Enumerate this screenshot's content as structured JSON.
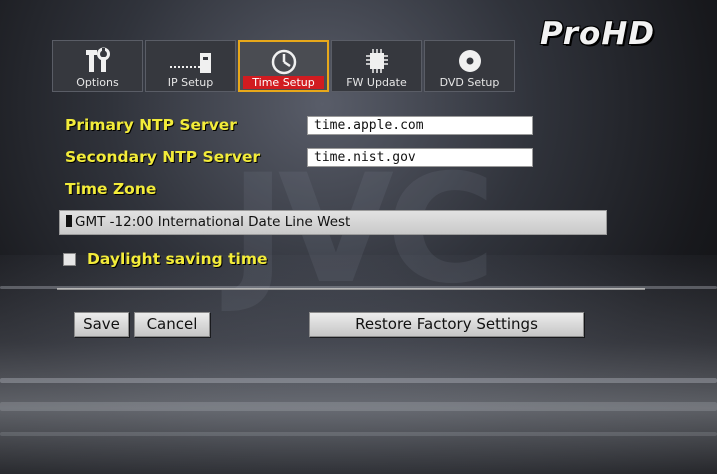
{
  "brand": "ProHD",
  "tabs": [
    {
      "label": "Options",
      "icon": "tools-icon"
    },
    {
      "label": "IP Setup",
      "icon": "network-plug-icon"
    },
    {
      "label": "Time Setup",
      "icon": "clock-icon",
      "active": true
    },
    {
      "label": "FW Update",
      "icon": "chip-icon"
    },
    {
      "label": "DVD Setup",
      "icon": "disc-icon"
    }
  ],
  "form": {
    "primary_ntp_label": "Primary NTP Server",
    "primary_ntp_value": "time.apple.com",
    "secondary_ntp_label": "Secondary NTP Server",
    "secondary_ntp_value": "time.nist.gov",
    "time_zone_label": "Time Zone",
    "time_zone_value": "GMT -12:00 International Date Line West",
    "daylight_label": "Daylight saving time",
    "daylight_checked": false
  },
  "buttons": {
    "save": "Save",
    "cancel": "Cancel",
    "restore": "Restore Factory Settings"
  },
  "colors": {
    "label_yellow": "#f3ec3a",
    "active_tab_border": "#e8a81a",
    "active_tab_label_bg": "#d11b20"
  }
}
